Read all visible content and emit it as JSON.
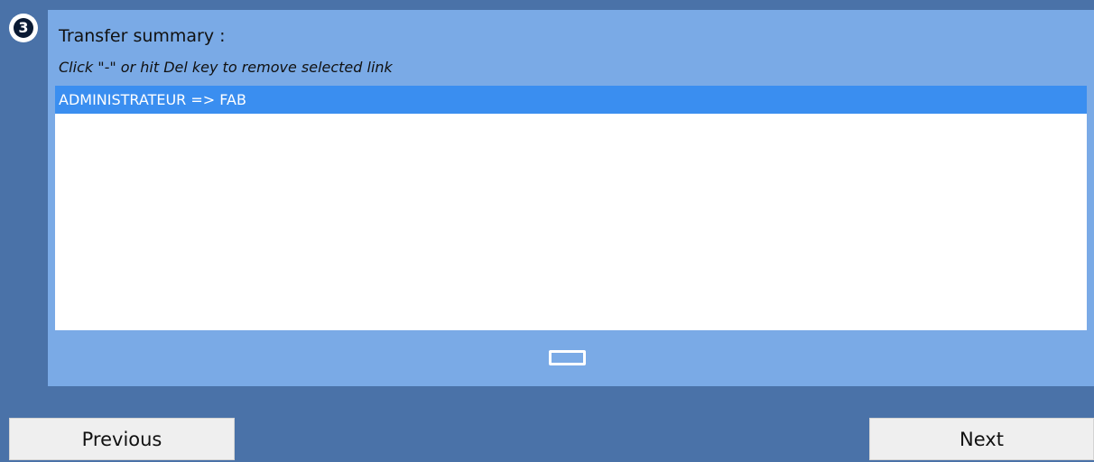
{
  "step": {
    "number": "3"
  },
  "summary": {
    "title": "Transfer summary :",
    "instruction": "Click \"-\" or hit Del key to remove selected link",
    "items": [
      {
        "label": "ADMINISTRATEUR => FAB",
        "selected": true
      }
    ],
    "remove_icon": "minus-rect-icon"
  },
  "navigation": {
    "previous_label": "Previous",
    "next_label": "Next"
  },
  "colors": {
    "background": "#4a72a8",
    "panel": "#7aaae6",
    "selection": "#3a8ef0",
    "button": "#efefef"
  }
}
